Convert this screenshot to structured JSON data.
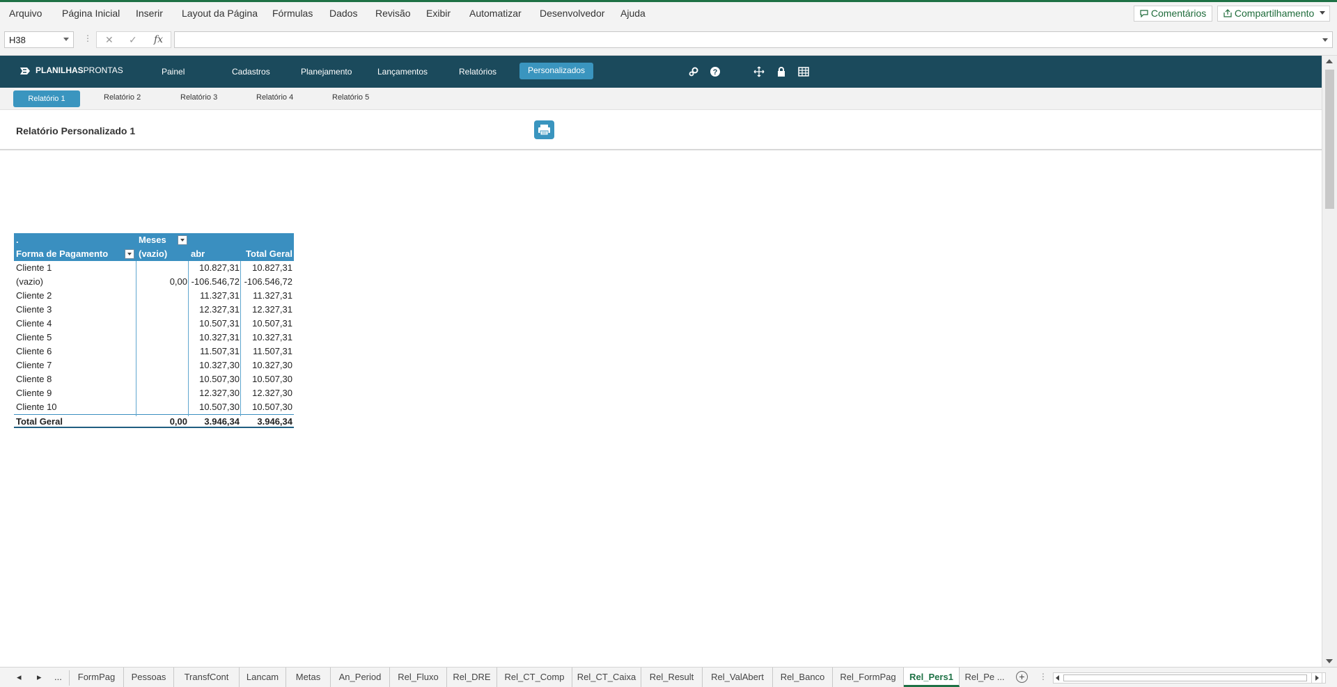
{
  "ribbon": {
    "tabs": [
      "Arquivo",
      "Página Inicial",
      "Inserir",
      "Layout da Página",
      "Fórmulas",
      "Dados",
      "Revisão",
      "Exibir",
      "Automatizar",
      "Desenvolvedor",
      "Ajuda"
    ],
    "comments_label": "Comentários",
    "share_label": "Compartilhamento"
  },
  "formula_bar": {
    "name_box": "H38",
    "fx_label": "fx",
    "value": ""
  },
  "app": {
    "logo_bold": "PLANILHAS",
    "logo_light": "PRONTAS",
    "nav": [
      "Painel",
      "Cadastros",
      "Planejamento",
      "Lançamentos",
      "Relatórios",
      "Personalizados"
    ],
    "active_nav": "Personalizados",
    "subtabs": [
      "Relatório 1",
      "Relatório 2",
      "Relatório 3",
      "Relatório 4",
      "Relatório 5"
    ],
    "page_title": "Relatório Personalizado 1"
  },
  "pivot": {
    "corner": ".",
    "column_field": "Meses",
    "row_field": "Forma de Pagamento",
    "columns": [
      "(vazio)",
      "abr",
      "Total Geral"
    ],
    "rows": [
      {
        "label": "Cliente 1",
        "vazio": "",
        "abr": "10.827,31",
        "total": "10.827,31"
      },
      {
        "label": "(vazio)",
        "vazio": "0,00",
        "abr": "-106.546,72",
        "total": "-106.546,72"
      },
      {
        "label": "Cliente 2",
        "vazio": "",
        "abr": "11.327,31",
        "total": "11.327,31"
      },
      {
        "label": "Cliente 3",
        "vazio": "",
        "abr": "12.327,31",
        "total": "12.327,31"
      },
      {
        "label": "Cliente 4",
        "vazio": "",
        "abr": "10.507,31",
        "total": "10.507,31"
      },
      {
        "label": "Cliente 5",
        "vazio": "",
        "abr": "10.327,31",
        "total": "10.327,31"
      },
      {
        "label": "Cliente 6",
        "vazio": "",
        "abr": "11.507,31",
        "total": "11.507,31"
      },
      {
        "label": "Cliente 7",
        "vazio": "",
        "abr": "10.327,30",
        "total": "10.327,30"
      },
      {
        "label": "Cliente 8",
        "vazio": "",
        "abr": "10.507,30",
        "total": "10.507,30"
      },
      {
        "label": "Cliente 9",
        "vazio": "",
        "abr": "12.327,30",
        "total": "12.327,30"
      },
      {
        "label": "Cliente 10",
        "vazio": "",
        "abr": "10.507,30",
        "total": "10.507,30"
      }
    ],
    "total": {
      "label": "Total Geral",
      "vazio": "0,00",
      "abr": "3.946,34",
      "total": "3.946,34"
    }
  },
  "sheets": {
    "ellipsis": "...",
    "tabs": [
      "FormPag",
      "Pessoas",
      "TransfCont",
      "Lancam",
      "Metas",
      "An_Period",
      "Rel_Fluxo",
      "Rel_DRE",
      "Rel_CT_Comp",
      "Rel_CT_Caixa",
      "Rel_Result",
      "Rel_ValAbert",
      "Rel_Banco",
      "Rel_FormPag",
      "Rel_Pers1",
      "Rel_Pe ..."
    ],
    "active": "Rel_Pers1"
  },
  "colors": {
    "excel_green": "#1e7145",
    "header_dark": "#1b4a5c",
    "accent_blue": "#3a95bf",
    "pivot_header": "#3a8fc0"
  },
  "icons": [
    "settings-icon",
    "help-icon",
    "move-icon",
    "lock-icon",
    "grid-icon",
    "print-icon",
    "comment-icon",
    "share-icon"
  ]
}
